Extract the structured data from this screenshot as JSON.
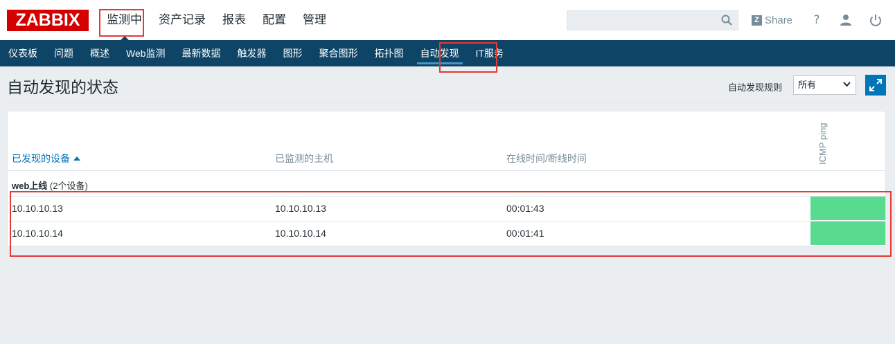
{
  "logo": "ZABBIX",
  "main_nav": [
    "监测中",
    "资产记录",
    "报表",
    "配置",
    "管理"
  ],
  "search": {
    "placeholder": "",
    "icon": "search-icon"
  },
  "share_label": "Share",
  "top_icons": [
    "help-icon",
    "user-icon",
    "power-icon"
  ],
  "help_glyph": "?",
  "sub_nav": [
    "仪表板",
    "问题",
    "概述",
    "Web监测",
    "最新数据",
    "触发器",
    "图形",
    "聚合图形",
    "拓扑图",
    "自动发现",
    "IT服务"
  ],
  "active_sub": "自动发现",
  "page_title": "自动发现的状态",
  "filter": {
    "label": "自动发现规则",
    "value": "所有"
  },
  "table": {
    "headers": {
      "device": "已发现的设备",
      "host": "已监测的主机",
      "uptime": "在线时间/断线时间",
      "check": "ICMP ping"
    },
    "group": {
      "name": "web上线",
      "count": "(2个设备)"
    },
    "rows": [
      {
        "device": "10.10.10.13",
        "host": "10.10.10.13",
        "uptime": "00:01:43",
        "status_color": "#59db8f"
      },
      {
        "device": "10.10.10.14",
        "host": "10.10.10.14",
        "uptime": "00:01:41",
        "status_color": "#59db8f"
      }
    ]
  },
  "colors": {
    "brand": "#d40000",
    "nav": "#0e4466",
    "link": "#0275b8",
    "ok": "#59db8f",
    "highlight": "#e53935"
  }
}
